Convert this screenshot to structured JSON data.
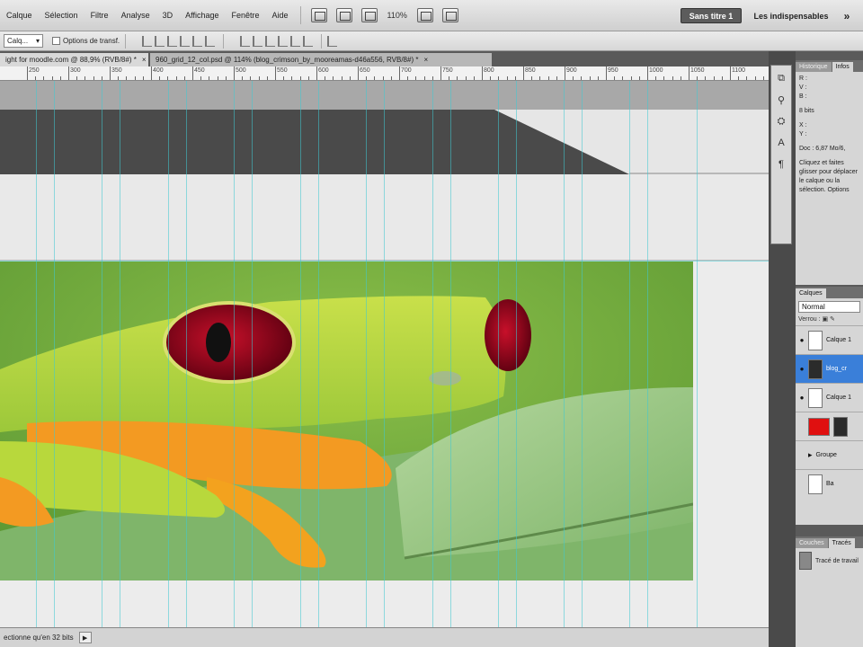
{
  "menubar": {
    "items": [
      "Calque",
      "Sélection",
      "Filtre",
      "Analyse",
      "3D",
      "Affichage",
      "Fenêtre",
      "Aide"
    ],
    "zoom": "110%",
    "workspace_active": "Sans titre 1",
    "workspace_other": "Les indispensables",
    "more": "»"
  },
  "options": {
    "target_select": "Calq...",
    "transform_label": "Options de transf."
  },
  "tabs": [
    {
      "label": "ight for moodle.com @ 88,9% (RVB/8#) *",
      "close": "×"
    },
    {
      "label": "960_grid_12_col.psd @ 114% (blog_crimson_by_mooreamas-d46a556, RVB/8#) *",
      "close": "×"
    }
  ],
  "ruler": {
    "labels": [
      "250",
      "300",
      "350",
      "400",
      "450",
      "500",
      "550",
      "600",
      "650",
      "700",
      "750",
      "800",
      "850",
      "900",
      "950",
      "1000",
      "1050",
      "1100"
    ]
  },
  "status": {
    "text": "ectionne qu'en 32 bits",
    "arrow": "▶"
  },
  "info_panel": {
    "tabs": [
      "Historique",
      "Infos"
    ],
    "rgb": [
      "R :",
      "V :",
      "B :"
    ],
    "bits": "8 bits",
    "xy": [
      "X :",
      "Y :"
    ],
    "doc": "Doc : 6,87 Mo/6,",
    "help": "Cliquez et faites glisser pour déplacer le calque ou la sélection. Options"
  },
  "layers_panel": {
    "tab": "Calques",
    "blend": "Normal",
    "lock": "Verrou :",
    "layers": [
      {
        "name": "Calque 1",
        "thumb": "white",
        "visible": true,
        "selected": false
      },
      {
        "name": "blog_cr",
        "thumb": "photo",
        "visible": true,
        "selected": true
      },
      {
        "name": "Calque 1",
        "thumb": "white",
        "visible": true,
        "selected": false
      },
      {
        "name": "",
        "thumb": "red",
        "visible": false,
        "selected": false
      },
      {
        "name": "Groupe",
        "thumb": "folder",
        "visible": false,
        "selected": false
      },
      {
        "name": "Ba",
        "thumb": "white",
        "visible": false,
        "selected": false
      }
    ]
  },
  "actions_panel": {
    "tabs": [
      "Couches",
      "Tracés"
    ],
    "item": "Tracé de travail"
  },
  "colors": {
    "header_dark": "#4a4a4a",
    "guide": "#40c8d2",
    "selection_blue": "#3a7fd9",
    "swatch_red": "#e01010"
  }
}
